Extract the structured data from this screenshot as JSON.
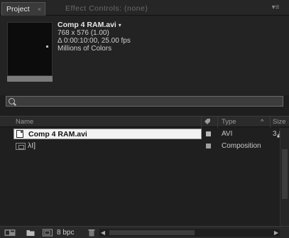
{
  "tabs": {
    "project": "Project",
    "effect_controls": "Effect Controls: (none)"
  },
  "preview": {
    "name": "Comp 4 RAM.avi",
    "caret": "▾",
    "dimensions": "768 x 576 (1.00)",
    "duration": "Δ 0:00:10:00, 25.00 fps",
    "colors": "Millions of Colors"
  },
  "search": {
    "value": "",
    "placeholder": ""
  },
  "columns": {
    "name": "Name",
    "type": "Type",
    "size": "Size"
  },
  "items": [
    {
      "name": "Comp 4 RAM.avi",
      "type": "AVI",
      "size": "3",
      "label_color": "#b8b8b8"
    },
    {
      "name": "λΙ]",
      "type": "Composition",
      "size": "",
      "label_color": "#a0a0a0"
    }
  ],
  "footer": {
    "bpc": "8 bpc"
  },
  "colors": {
    "accent": "#f2f2f2",
    "panel": "#1f1f1f"
  }
}
